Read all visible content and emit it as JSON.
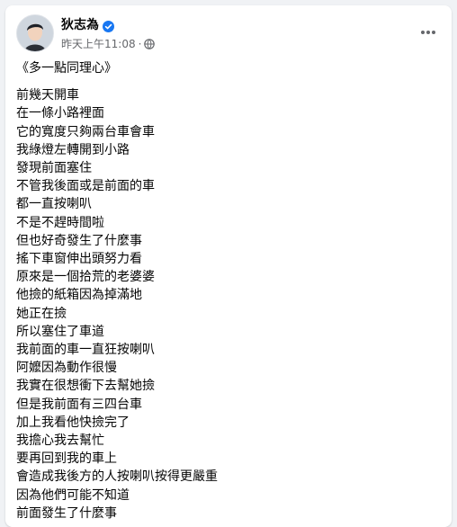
{
  "post": {
    "author": "狄志為",
    "timestamp": "昨天上午11:08",
    "separator": "·",
    "audience_icon": "globe-icon",
    "verified_icon": "verified-badge-icon",
    "more_icon": "more-options-icon",
    "accent_color": "#1877f2",
    "title": "《多一點同理心》",
    "lines": [
      "前幾天開車",
      "在一條小路裡面",
      "它的寬度只夠兩台車會車",
      "我綠燈左轉開到小路",
      "發現前面塞住",
      "不管我後面或是前面的車",
      "都一直按喇叭",
      "不是不趕時間啦",
      "但也好奇發生了什麼事",
      "搖下車窗伸出頭努力看",
      "原來是一個拾荒的老婆婆",
      "他撿的紙箱因為掉滿地",
      "她正在撿",
      "所以塞住了車道",
      "我前面的車一直狂按喇叭",
      "阿嬤因為動作很慢",
      "我實在很想衝下去幫她撿",
      "但是我前面有三四台車",
      "加上我看他快撿完了",
      "我擔心我去幫忙",
      "要再回到我的車上",
      "會造成我後方的人按喇叭按得更嚴重",
      "因為他們可能不知道",
      "前面發生了什麼事"
    ]
  }
}
